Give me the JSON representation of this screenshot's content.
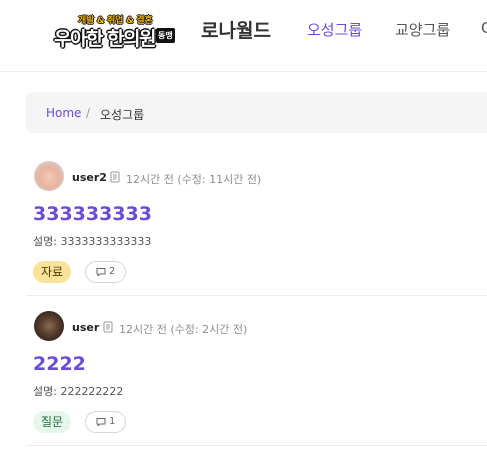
{
  "header": {
    "logo": {
      "subtitle": "개발 & 취업 & 결혼",
      "main": "우아한 한의원",
      "tag": "동맹"
    },
    "brand": "로나월드",
    "nav": [
      {
        "label": "오성그룹",
        "active": true
      },
      {
        "label": "교양그룹",
        "active": false
      },
      {
        "label": "C",
        "active": false
      }
    ]
  },
  "breadcrumb": {
    "home": "Home",
    "separator": "/",
    "current": "오성그룹"
  },
  "posts": [
    {
      "author": "user2",
      "time": "12시간 전 (수정: 11시간 전)",
      "title": "333333333",
      "description": "설명: 3333333333333",
      "tag": "자료",
      "comments": "2"
    },
    {
      "author": "user",
      "time": "12시간 전 (수정: 2시간 전)",
      "title": "2222",
      "description": "설명: 222222222",
      "tag": "질문",
      "comments": "1"
    }
  ],
  "colors": {
    "accent": "#6c4bd6",
    "tag_resource_bg": "#f9e29a",
    "tag_question_bg": "#e7f6ec"
  },
  "icons": {
    "meta": "document-icon",
    "comment": "comment-icon"
  }
}
